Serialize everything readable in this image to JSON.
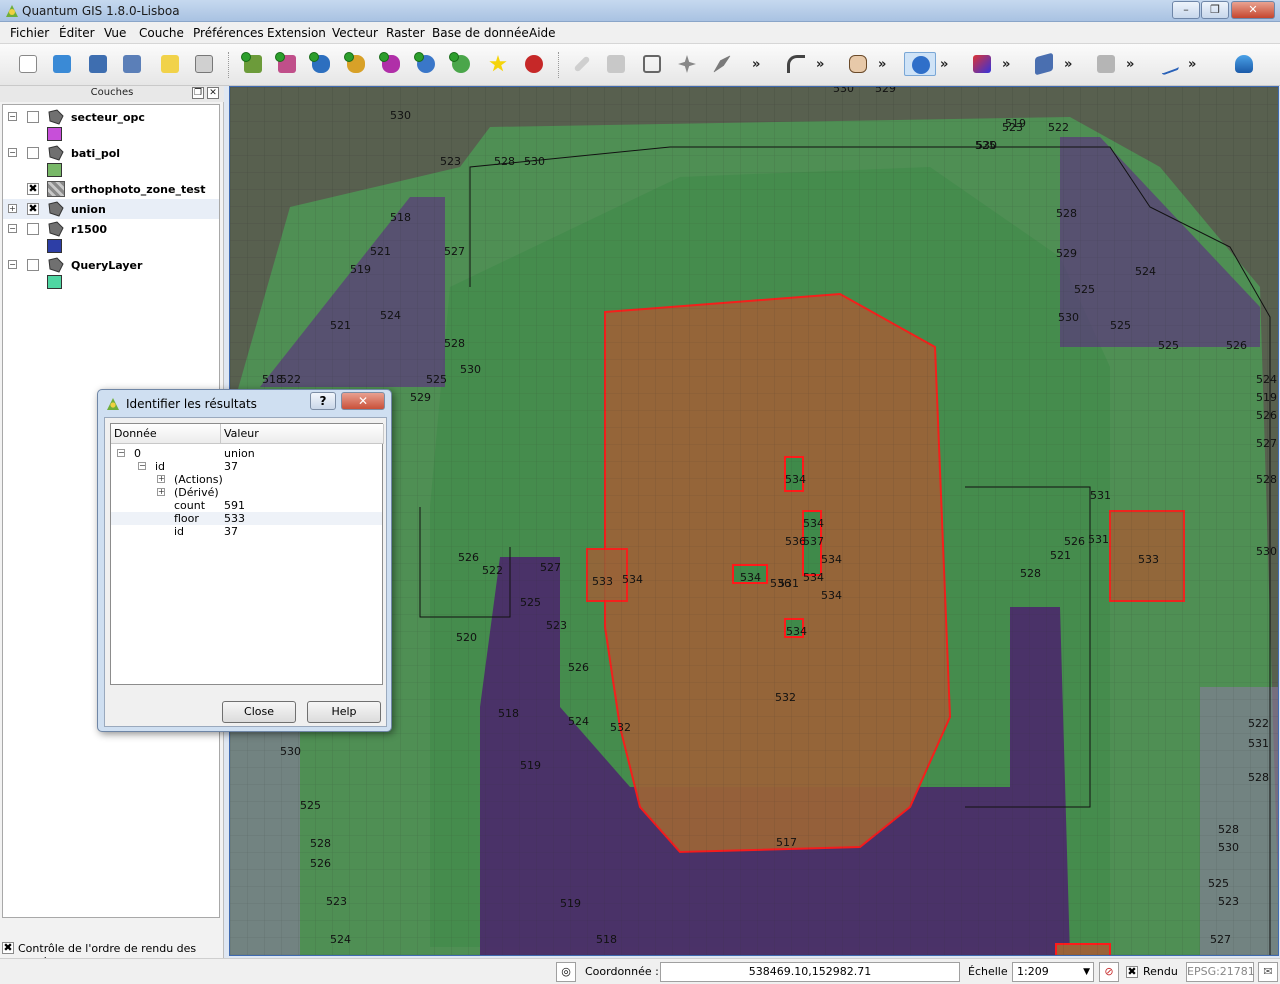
{
  "window": {
    "title": "Quantum GIS 1.8.0-Lisboa",
    "minimize": "–",
    "maximize": "❐",
    "close": "✕"
  },
  "menu": [
    "Fichier",
    "Éditer",
    "Vue",
    "Couche",
    "Préférences",
    "Extension",
    "Vecteur",
    "Raster",
    "Base de donnée",
    "Aide"
  ],
  "toolbar": {
    "overflow": "»",
    "icons": [
      "new-project-icon",
      "open-project-icon",
      "save-project-icon",
      "save-as-icon",
      "new-print-composer-icon",
      "print-icon",
      "add-vector-layer-icon",
      "add-raster-layer-icon",
      "add-postgis-layer-icon",
      "add-spatialite-layer-icon",
      "add-wms-layer-icon",
      "add-wfs-layer-icon",
      "new-shapefile-icon",
      "remove-layer-icon",
      "toggle-editing-icon",
      "save-edits-icon",
      "add-feature-icon",
      "move-feature-icon",
      "node-tool-icon",
      "undo-icon",
      "pan-icon",
      "identify-icon",
      "postgis-manager-icon",
      "open-table-icon",
      "field-calculator-icon",
      "label-icon",
      "spatialite-icon"
    ]
  },
  "layers_panel": {
    "title": "Couches",
    "layers": [
      {
        "name": "secteur_opc",
        "checked": false,
        "swatch": "#c74fd9"
      },
      {
        "name": "bati_pol",
        "checked": false,
        "swatch": "#78b868"
      },
      {
        "name": "orthophoto_zone_test",
        "checked": true
      },
      {
        "name": "union",
        "checked": true
      },
      {
        "name": "r1500",
        "checked": false,
        "swatch": "#2d3ea6"
      },
      {
        "name": "QueryLayer",
        "checked": false,
        "swatch": "#4fd6a2"
      }
    ],
    "checked_mark": "✖",
    "render_order_label": "Contrôle de l'ordre de rendu des couches"
  },
  "identify_dialog": {
    "title": "Identifier les résultats",
    "help_btn": "?",
    "close_x": "✕",
    "columns": [
      "Donnée",
      "Valeur"
    ],
    "rows": [
      {
        "key": "0",
        "value": "union"
      },
      {
        "key": "id",
        "value": "37"
      },
      {
        "key": "(Actions)",
        "value": ""
      },
      {
        "key": "(Dérivé)",
        "value": ""
      },
      {
        "key": "count",
        "value": "591"
      },
      {
        "key": "floor",
        "value": "533"
      },
      {
        "key": "id",
        "value": "37"
      }
    ],
    "close_button": "Close",
    "help_button": "Help"
  },
  "statusbar": {
    "coord_label": "Coordonnée :",
    "coord_value": "538469.10,152982.71",
    "scale_label": "Échelle",
    "scale_value": "1:209",
    "render_label": "Rendu",
    "crs": "EPSG:21781"
  },
  "map": {
    "labels": [
      "530",
      "529",
      "525",
      "519",
      "523",
      "522",
      "526",
      "521",
      "527",
      "528",
      "520",
      "524",
      "518",
      "517",
      "531",
      "532",
      "533",
      "534",
      "536",
      "537",
      "536",
      "537"
    ],
    "colors": {
      "green": "#4d9a55",
      "purple": "#4b2a6a",
      "brown": "#9a6338",
      "selection": "#ff1a1a"
    }
  }
}
